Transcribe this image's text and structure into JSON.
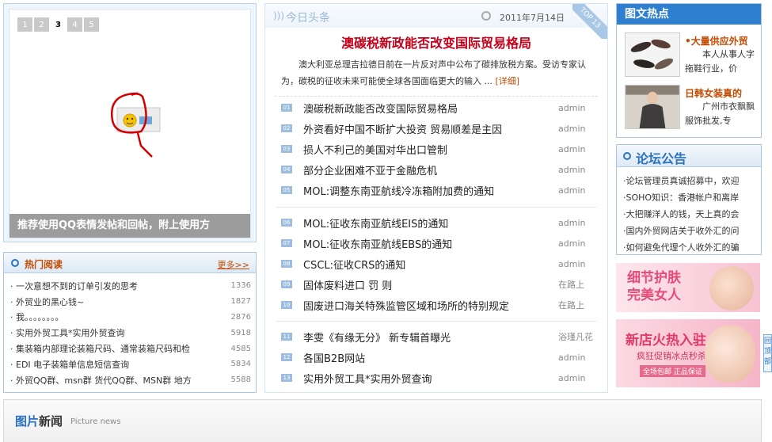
{
  "slideshow": {
    "pages": [
      "1",
      "2",
      "3",
      "4",
      "5"
    ],
    "active_page": "3",
    "caption": "推荐使用QQ表情发帖和回帖，附上使用方"
  },
  "hot_reading": {
    "title": "热门阅读",
    "more": "更多>>",
    "items": [
      {
        "title": "一次意想不到的订单引发的思考",
        "count": "1336"
      },
      {
        "title": "外贸业的黑心钱~",
        "count": "1827"
      },
      {
        "title": "我。。。。。。。。",
        "count": "2876"
      },
      {
        "title": "实用外贸工具*实用外贸查询",
        "count": "5918"
      },
      {
        "title": "集装箱内部理论装箱尺码、通常装箱尺码和检",
        "count": "4585"
      },
      {
        "title": "EDI 电子装箱单信息短信查询",
        "count": "5834"
      },
      {
        "title": "外贸QQ群、msn群 货代QQ群、MSN群 地方",
        "count": "5588"
      }
    ]
  },
  "top_news": {
    "label": "今日头条",
    "date": "2011年7月14日",
    "ribbon": "TOP 13",
    "headline": "澳碳税新政能否改变国际贸易格局",
    "summary": "澳大利亚总理吉拉德日前在一片反对声中公布了碳排放税方案。受访专家认为，碳税的征收未来可能使全球各国面临更大的输入 ...",
    "summary_more": "[详细]"
  },
  "news_groups": [
    [
      {
        "num": "01",
        "title": "澳碳税新政能否改变国际贸易格局",
        "author": "admin"
      },
      {
        "num": "02",
        "title": "外资看好中国不断扩大投资 贸易顺差是主因",
        "author": "admin"
      },
      {
        "num": "03",
        "title": "损人不利己的美国对华出口管制",
        "author": "admin"
      },
      {
        "num": "04",
        "title": "部分企业困难不亚于金融危机",
        "author": "admin"
      },
      {
        "num": "05",
        "title": "MOL:调整东南亚航线冷冻箱附加费的通知",
        "author": "admin"
      }
    ],
    [
      {
        "num": "06",
        "title": "MOL:征收东南亚航线EIS的通知",
        "author": "admin"
      },
      {
        "num": "07",
        "title": "MOL:征收东南亚航线EBS的通知",
        "author": "admin"
      },
      {
        "num": "08",
        "title": "CSCL:征收CRS的通知",
        "author": "admin"
      },
      {
        "num": "09",
        "title": "固体废料进口 罚  则",
        "author": "在路上"
      },
      {
        "num": "10",
        "title": "固废进口海关特殊监管区域和场所的特别规定",
        "author": "在路上"
      }
    ],
    [
      {
        "num": "11",
        "title": "李雯《有缘无分》 新专辑首曝光",
        "author": "浴瑾凡花"
      },
      {
        "num": "12",
        "title": "各国B2B网站",
        "author": "admin"
      },
      {
        "num": "13",
        "title": "实用外贸工具*实用外贸查询",
        "author": "admin"
      }
    ]
  ],
  "pic_hot": {
    "title": "图文热点",
    "items": [
      {
        "title": "•大量供应外贸",
        "desc": "本人从事人字拖鞋行业，价"
      },
      {
        "title": "日韩女装真的",
        "desc": "广州市衣飘飘服饰批发,专"
      }
    ]
  },
  "forum": {
    "title": "论坛公告",
    "items": [
      "·论坛管理员真诚招募中，欢迎",
      "·SOHO知识：香港帐户和离岸",
      "·大把赚洋人的钱，天上真的会",
      "·国内外贸网店关于收外汇的问",
      "·如何避免代理个人收外汇的骗"
    ]
  },
  "ads": {
    "ad1_line1": "细节护肤",
    "ad1_line2": "完美女人",
    "ad2_line1": "新店火热入驻",
    "ad2_line2": "疯狂促销冰点秒杀",
    "ad2_tag": "全场包邮 正品保证"
  },
  "side_tab": "回顶部",
  "picture_news": {
    "title_part1": "图片",
    "title_part2": "新闻",
    "subtitle": "Picture news"
  },
  "colors": {
    "accent_blue": "#2e7fd0",
    "headline_red": "#c4001b",
    "orange": "#c34a00"
  }
}
